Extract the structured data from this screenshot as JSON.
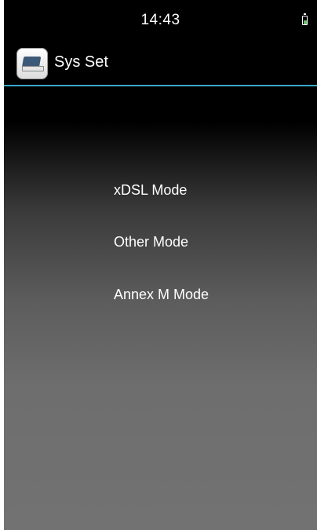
{
  "status_bar": {
    "time": "14:43",
    "battery_icon": "battery-icon",
    "battery_color": "#6ac36a"
  },
  "header": {
    "icon": "settings-app-icon",
    "title": "Sys Set",
    "divider_color": "#3aa6c8"
  },
  "menu": {
    "items": [
      {
        "label": "xDSL Mode"
      },
      {
        "label": "Other Mode"
      },
      {
        "label": "Annex M Mode"
      }
    ]
  }
}
